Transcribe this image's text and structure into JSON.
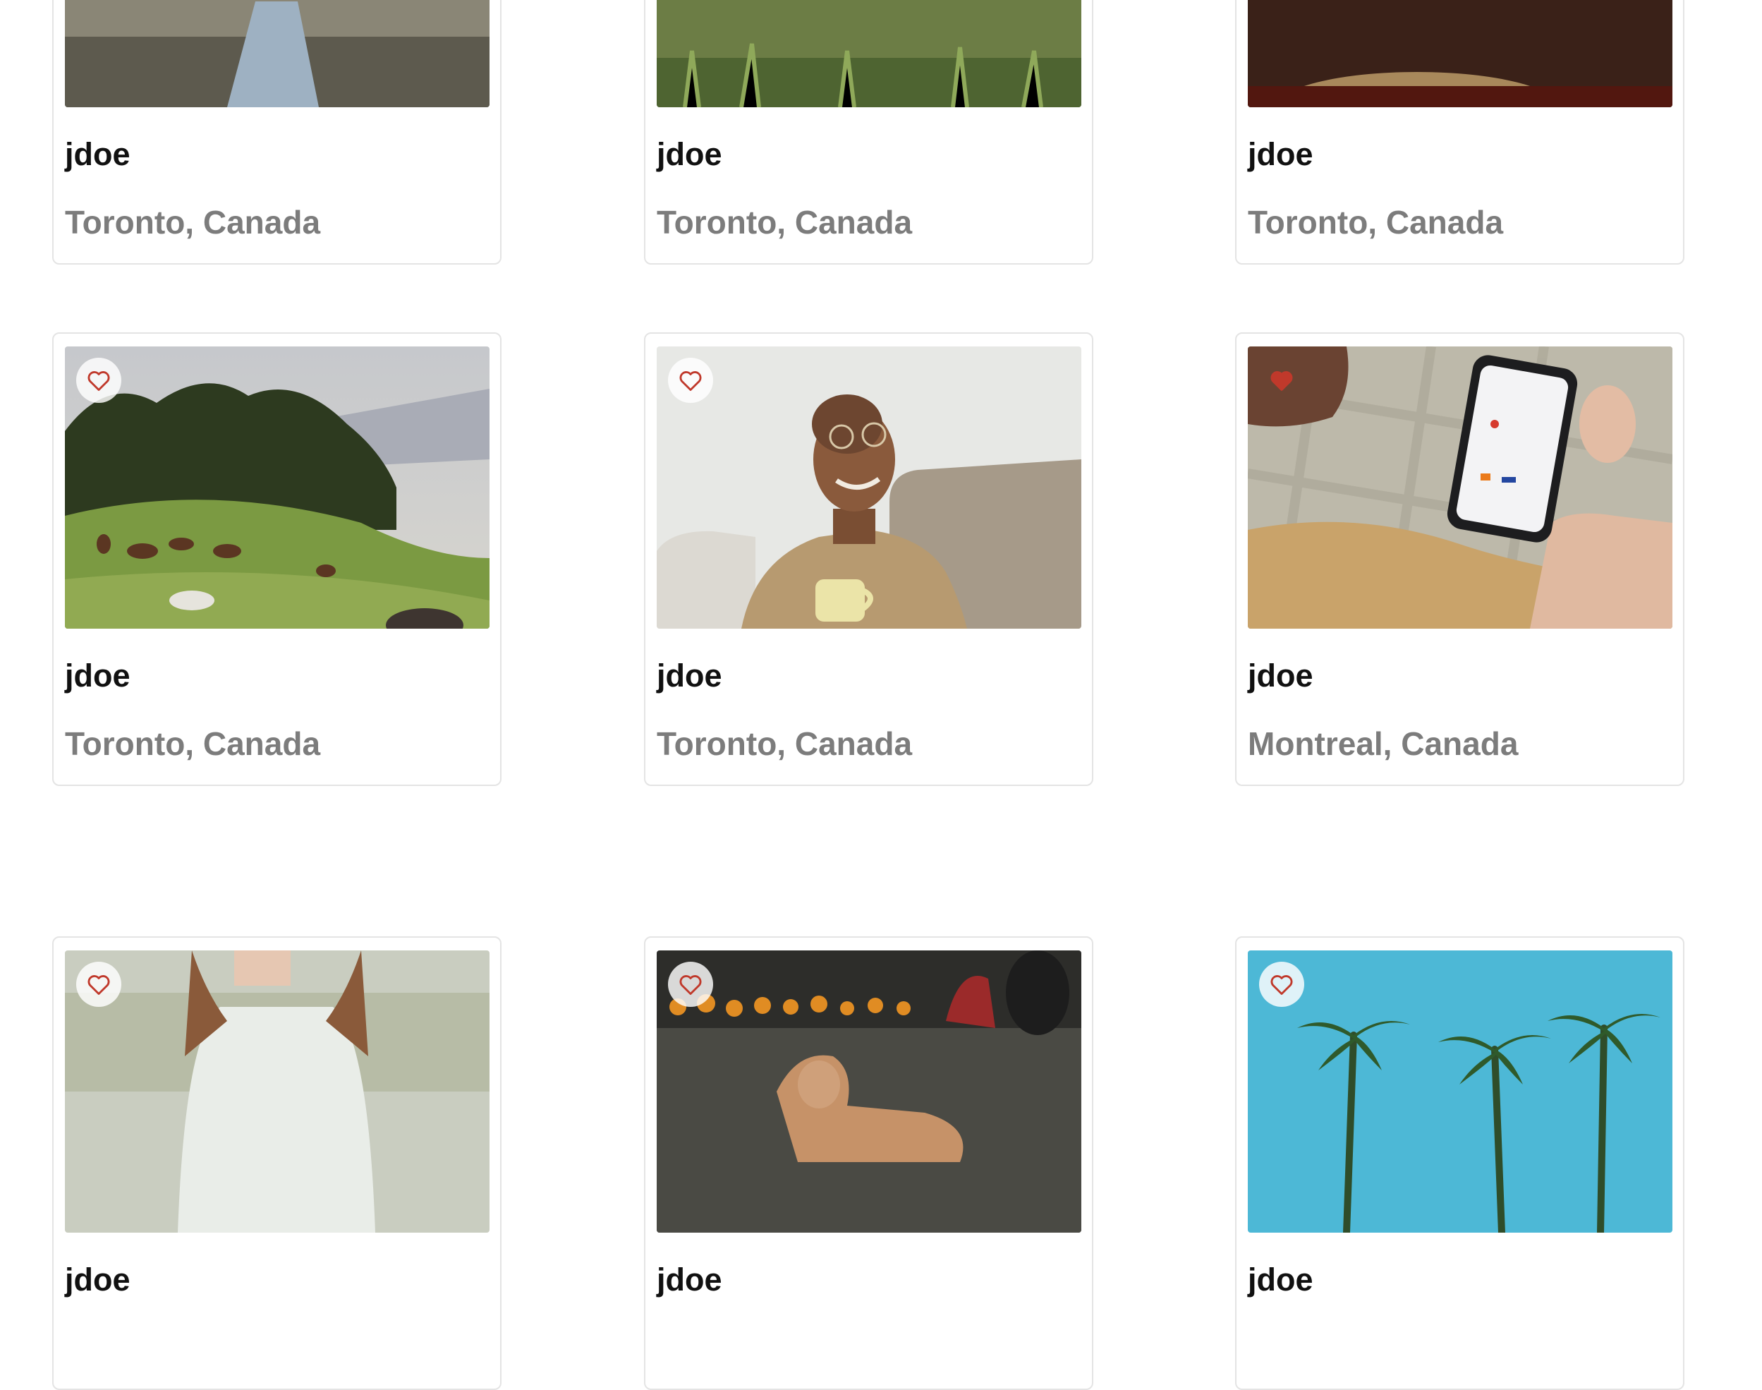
{
  "colors": {
    "heart": "#c0392b",
    "card_border": "#e4e4e4",
    "location_text": "#7c7c7c"
  },
  "listings": [
    {
      "user": "jdoe",
      "location": "Toronto, Canada",
      "photo": "partial-photo-grey",
      "favorited": false
    },
    {
      "user": "jdoe",
      "location": "Toronto, Canada",
      "photo": "partial-photo-grass",
      "favorited": false
    },
    {
      "user": "jdoe",
      "location": "Toronto, Canada",
      "photo": "partial-photo-dark",
      "favorited": false
    },
    {
      "user": "jdoe",
      "location": "Toronto, Canada",
      "photo": "photo-horses-hillside",
      "favorited": false
    },
    {
      "user": "jdoe",
      "location": "Toronto, Canada",
      "photo": "photo-man-with-mug",
      "favorited": false
    },
    {
      "user": "jdoe",
      "location": "Montreal, Canada",
      "photo": "photo-phone-payment",
      "favorited": true
    },
    {
      "user": "jdoe",
      "location": "",
      "photo": "photo-woman-lake",
      "favorited": false
    },
    {
      "user": "jdoe",
      "location": "",
      "photo": "photo-dog-flowers",
      "favorited": false
    },
    {
      "user": "jdoe",
      "location": "",
      "photo": "photo-palm-trees",
      "favorited": false
    }
  ]
}
